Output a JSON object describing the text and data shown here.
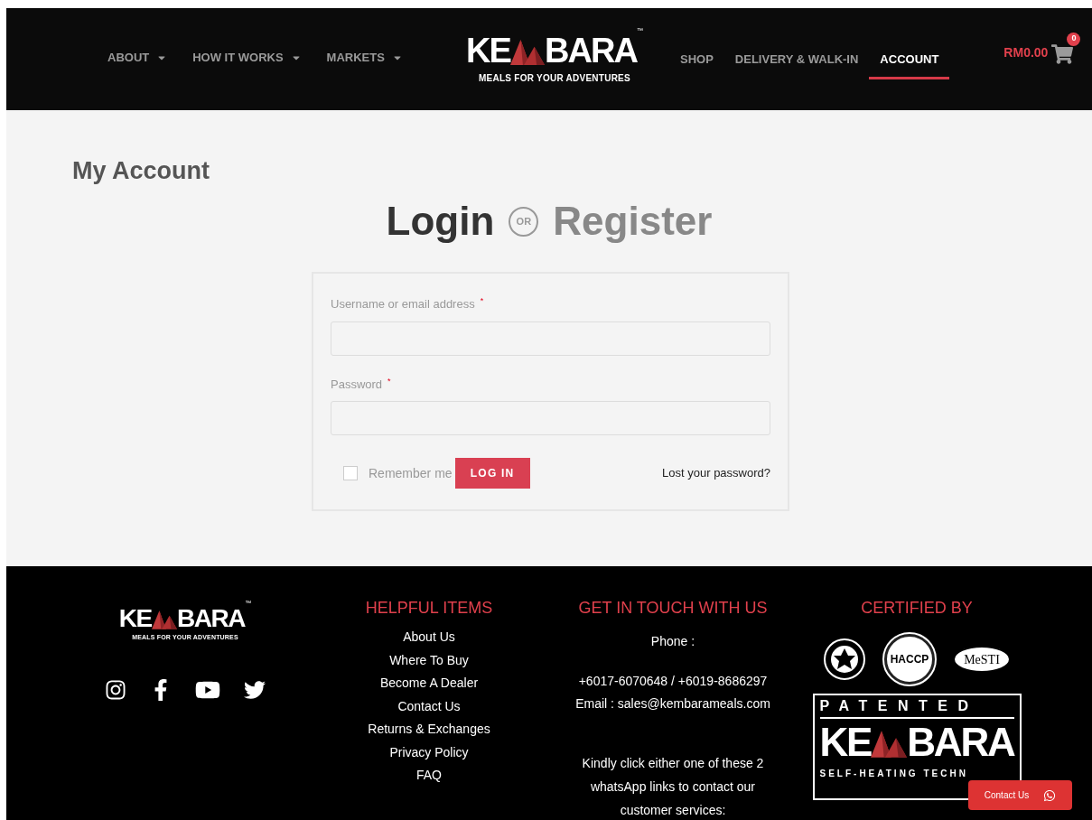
{
  "header": {
    "nav_left": [
      {
        "label": "ABOUT",
        "has_menu": true,
        "selected": false
      },
      {
        "label": "HOW IT WORKS",
        "has_menu": true,
        "selected": false
      },
      {
        "label": "MARKETS",
        "has_menu": true,
        "selected": false
      }
    ],
    "logo": {
      "left": "KE",
      "right": "BARA",
      "tm": "™",
      "tagline": "MEALS FOR YOUR ADVENTURES"
    },
    "nav_right": [
      {
        "label": "SHOP",
        "has_menu": false,
        "selected": false
      },
      {
        "label": "DELIVERY & WALK-IN",
        "has_menu": false,
        "selected": false
      },
      {
        "label": "ACCOUNT",
        "has_menu": false,
        "selected": true
      }
    ],
    "cart": {
      "total": "RM0.00",
      "count": "0"
    }
  },
  "page_title": "My Account",
  "auth_heading": {
    "login": "Login",
    "or": "OR",
    "register": "Register"
  },
  "login_form": {
    "fields": [
      {
        "label": "Username or email address",
        "required_mark": "*"
      },
      {
        "label": "Password",
        "required_mark": "*"
      }
    ],
    "remember": {
      "label": "Remember me",
      "checked": false
    },
    "submit": "LOG IN",
    "lost_password": "Lost your password?"
  },
  "footer": {
    "logo": {
      "left": "KE",
      "right": "BARA",
      "tm": "™",
      "tagline": "MEALS FOR YOUR ADVENTURES"
    },
    "social": [
      {
        "kind": "instagram"
      },
      {
        "kind": "facebook"
      },
      {
        "kind": "youtube"
      },
      {
        "kind": "twitter"
      }
    ],
    "helpful": {
      "title": "HELPFUL ITEMS",
      "links": [
        "About Us",
        "Where To Buy",
        "Become A Dealer",
        "Contact Us",
        "Returns & Exchanges",
        "Privacy Policy",
        "FAQ"
      ]
    },
    "contact": {
      "title": "GET IN TOUCH WITH US",
      "phone_label": "Phone :",
      "phones": "+6017-6070648 / +6019-8686297",
      "email": "Email : sales@kembarameals.com",
      "note": "Kindly click either one of these 2 whatsApp links to contact our customer services:"
    },
    "certified": {
      "title": "CERTIFIED BY",
      "badges": [
        {
          "kind": "seal"
        },
        {
          "kind": "round",
          "text": "HACCP"
        },
        {
          "kind": "oval",
          "text": "MeSTI"
        }
      ],
      "patent": {
        "top": "PATENTED",
        "left": "KE",
        "right": "BARA",
        "bottom": "SELF-HEATING TECHN"
      }
    }
  },
  "contact_button": {
    "label": "Contact Us"
  }
}
